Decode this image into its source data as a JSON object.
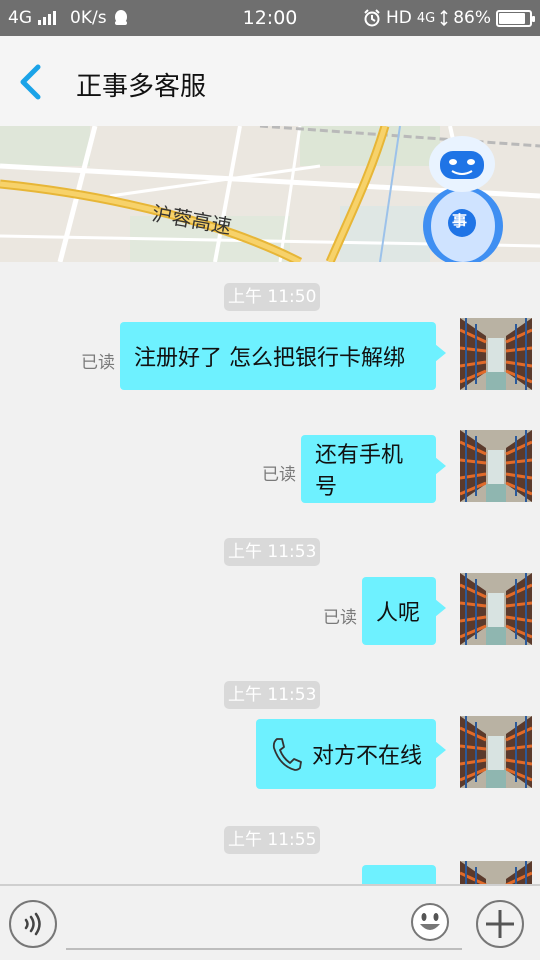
{
  "status_bar": {
    "network": "4G",
    "speed": "0K/s",
    "time": "12:00",
    "hd": "HD",
    "network_right": "4G",
    "battery": "86%",
    "battery_level": 0.86
  },
  "header": {
    "title": "正事多客服",
    "back_icon": "chevron-left-icon"
  },
  "banner": {
    "road_label": "沪蓉高速",
    "mascot_badge": "事"
  },
  "chat": {
    "messages": [
      {
        "type": "time",
        "text": "上午 11:50"
      },
      {
        "type": "text",
        "text": "注册好了  怎么把银行卡解绑",
        "read": "已读"
      },
      {
        "type": "text",
        "text": "还有手机号",
        "read": "已读"
      },
      {
        "type": "time",
        "text": "上午 11:53"
      },
      {
        "type": "text",
        "text": "人呢",
        "read": "已读"
      },
      {
        "type": "time",
        "text": "上午 11:53"
      },
      {
        "type": "call",
        "text": "对方不在线",
        "icon": "phone-icon"
      },
      {
        "type": "time",
        "text": "上午 11:55"
      }
    ]
  },
  "input_bar": {
    "voice_icon": "voice-icon",
    "input_placeholder": "",
    "emoji_icon": "smiley-icon",
    "plus_icon": "plus-icon"
  },
  "colors": {
    "bubble": "#6ef1ff",
    "accent": "#1aa3e8",
    "status_bar": "#6f6f6f"
  }
}
